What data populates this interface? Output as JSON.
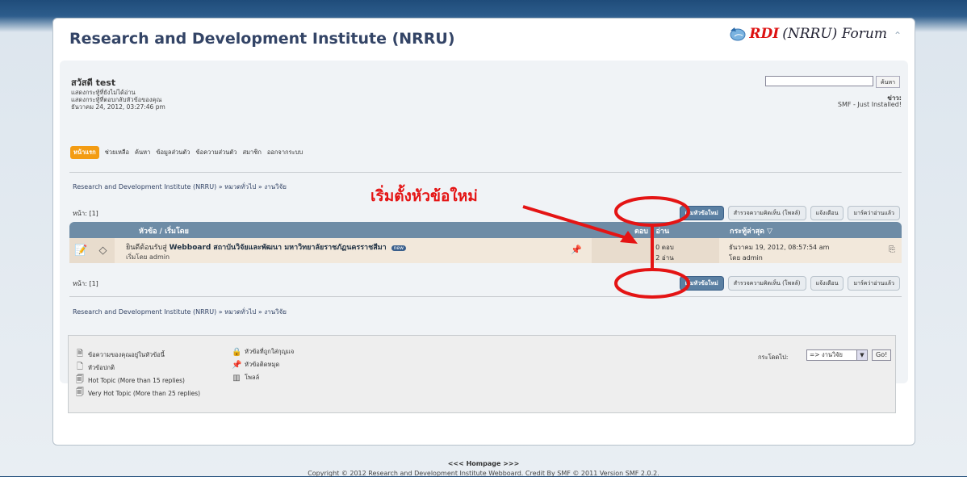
{
  "header": {
    "forum_title": "Research and Development Institute (NRRU)",
    "logo_rdi": "RDI",
    "logo_rest": "(NRRU) Forum"
  },
  "user": {
    "greeting": "สวัสดี test",
    "line1": "แสดงกระทู้ที่ยังไม่ได้อ่าน",
    "line2": "แสดงกระทู้ที่ตอบกลับหัวข้อของคุณ",
    "datetime": "ธันวาคม 24, 2012, 03:27:46 pm",
    "search_button": "ค้นหา",
    "news_label": "ข่าว:",
    "news_text": "SMF - Just Installed!"
  },
  "menu": {
    "items": [
      "หน้าแรก",
      "ช่วยเหลือ",
      "ค้นหา",
      "ข้อมูลส่วนตัว",
      "ข้อความส่วนตัว",
      "สมาชิก",
      "ออกจากระบบ"
    ]
  },
  "breadcrumb": "Research and Development Institute (NRRU) » หมวดทั่วไป » งานวิจัย",
  "pages_label": "หน้า: [1]",
  "buttons": {
    "new_topic": "เริ่มหัวข้อใหม่",
    "new_poll": "สำรวจความคิดเห็น (โพลล์)",
    "notify": "แจ้งเตือน",
    "mark_read": "มาร์คว่าอ่านแล้ว"
  },
  "table": {
    "col_subject": "หัวข้อ / เริ่มโดย",
    "col_stats": "ตอบ / อ่าน",
    "col_last": "กระทู้ล่าสุด ▽",
    "rows": [
      {
        "title_prefix": "ยินดีต้อนรับสู่",
        "title_bold": "Webboard",
        "title_rest": "สถาบันวิจัยและพัฒนา มหาวิทยาลัยราชภัฏนครราชสีมา",
        "badge": "new",
        "started_by": "เริ่มโดย admin",
        "replies": "0 ตอบ",
        "views": "2 อ่าน",
        "last_date": "ธันวาคม 19, 2012, 08:57:54 am",
        "last_by": "โดย admin"
      }
    ]
  },
  "legend": {
    "participated": "ข้อความของคุณอยู่ในหัวข้อนี้",
    "normal": "หัวข้อปกติ",
    "hot": "Hot Topic (More than 15 replies)",
    "very_hot": "Very Hot Topic (More than 25 replies)",
    "locked": "หัวข้อที่ถูกใส่กุญแจ",
    "sticky": "หัวข้อติดหมุด",
    "poll": "โพลล์",
    "jump_label": "กระโดดไป:",
    "jump_value": "=> งานวิจัย",
    "go": "Go!"
  },
  "footer": {
    "home": "<<< Hompage >>>",
    "copyright": "Copyright © 2012 Research and Development Institute Webboard. Credit By SMF © 2011 Version SMF 2.0.2."
  },
  "annotation": {
    "text": "เริ่มตั้งหัวข้อใหม่",
    "color": "#e41414"
  }
}
